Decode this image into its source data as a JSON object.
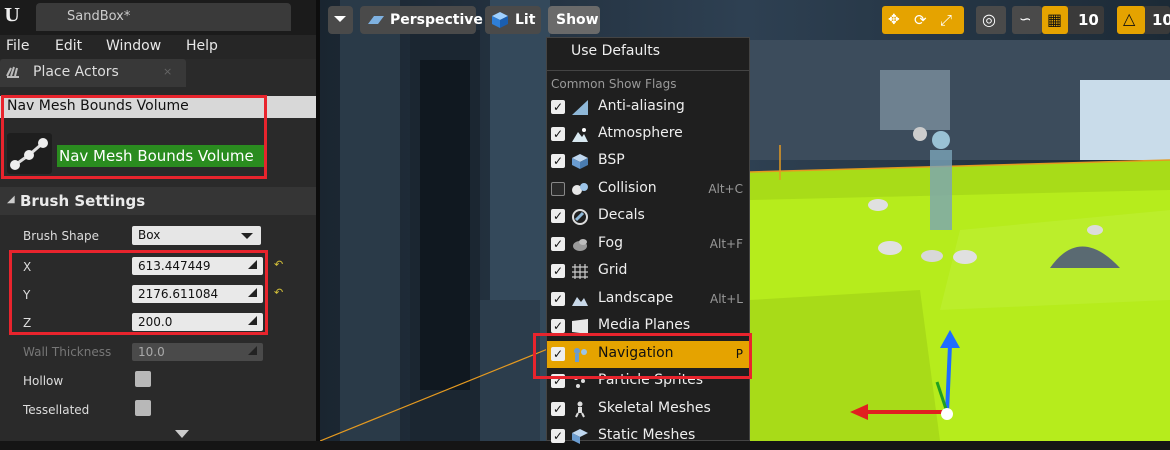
{
  "window": {
    "logo": "U",
    "tab_title": "SandBox*"
  },
  "menubar": {
    "items": [
      "File",
      "Edit",
      "Window",
      "Help"
    ]
  },
  "place_actors": {
    "tab_label": "Place Actors",
    "close_glyph": "×",
    "search_value": "Nav Mesh Bounds Volume",
    "actor_name": "Nav Mesh Bounds Volume"
  },
  "brush_settings": {
    "section_title": "Brush Settings",
    "brush_shape_label": "Brush Shape",
    "brush_shape_value": "Box",
    "x_label": "X",
    "x_value": "613.447449",
    "y_label": "Y",
    "y_value": "2176.611084",
    "z_label": "Z",
    "z_value": "200.0",
    "wall_thickness_label": "Wall Thickness",
    "wall_thickness_value": "10.0",
    "hollow_label": "Hollow",
    "tessellated_label": "Tessellated"
  },
  "viewport_toolbar": {
    "perspective_label": "Perspective",
    "lit_label": "Lit",
    "show_label": "Show",
    "grid_snap_value": "10",
    "rotation_snap_value": "10"
  },
  "show_menu": {
    "use_defaults": "Use Defaults",
    "category": "Common Show Flags",
    "items": [
      {
        "label": "Anti-aliasing",
        "checked": true,
        "shortcut": ""
      },
      {
        "label": "Atmosphere",
        "checked": true,
        "shortcut": ""
      },
      {
        "label": "BSP",
        "checked": true,
        "shortcut": ""
      },
      {
        "label": "Collision",
        "checked": false,
        "shortcut": "Alt+C"
      },
      {
        "label": "Decals",
        "checked": true,
        "shortcut": ""
      },
      {
        "label": "Fog",
        "checked": true,
        "shortcut": "Alt+F"
      },
      {
        "label": "Grid",
        "checked": true,
        "shortcut": ""
      },
      {
        "label": "Landscape",
        "checked": true,
        "shortcut": "Alt+L"
      },
      {
        "label": "Media Planes",
        "checked": true,
        "shortcut": ""
      },
      {
        "label": "Navigation",
        "checked": true,
        "shortcut": "P"
      },
      {
        "label": "Particle Sprites",
        "checked": true,
        "shortcut": ""
      },
      {
        "label": "Skeletal Meshes",
        "checked": true,
        "shortcut": ""
      },
      {
        "label": "Static Meshes",
        "checked": true,
        "shortcut": ""
      }
    ]
  },
  "colors": {
    "highlight": "#e5a300",
    "annotation_red": "#e8242d",
    "actor_label_green": "#2a8c1f",
    "navmesh_green": "#b6ec1c"
  }
}
